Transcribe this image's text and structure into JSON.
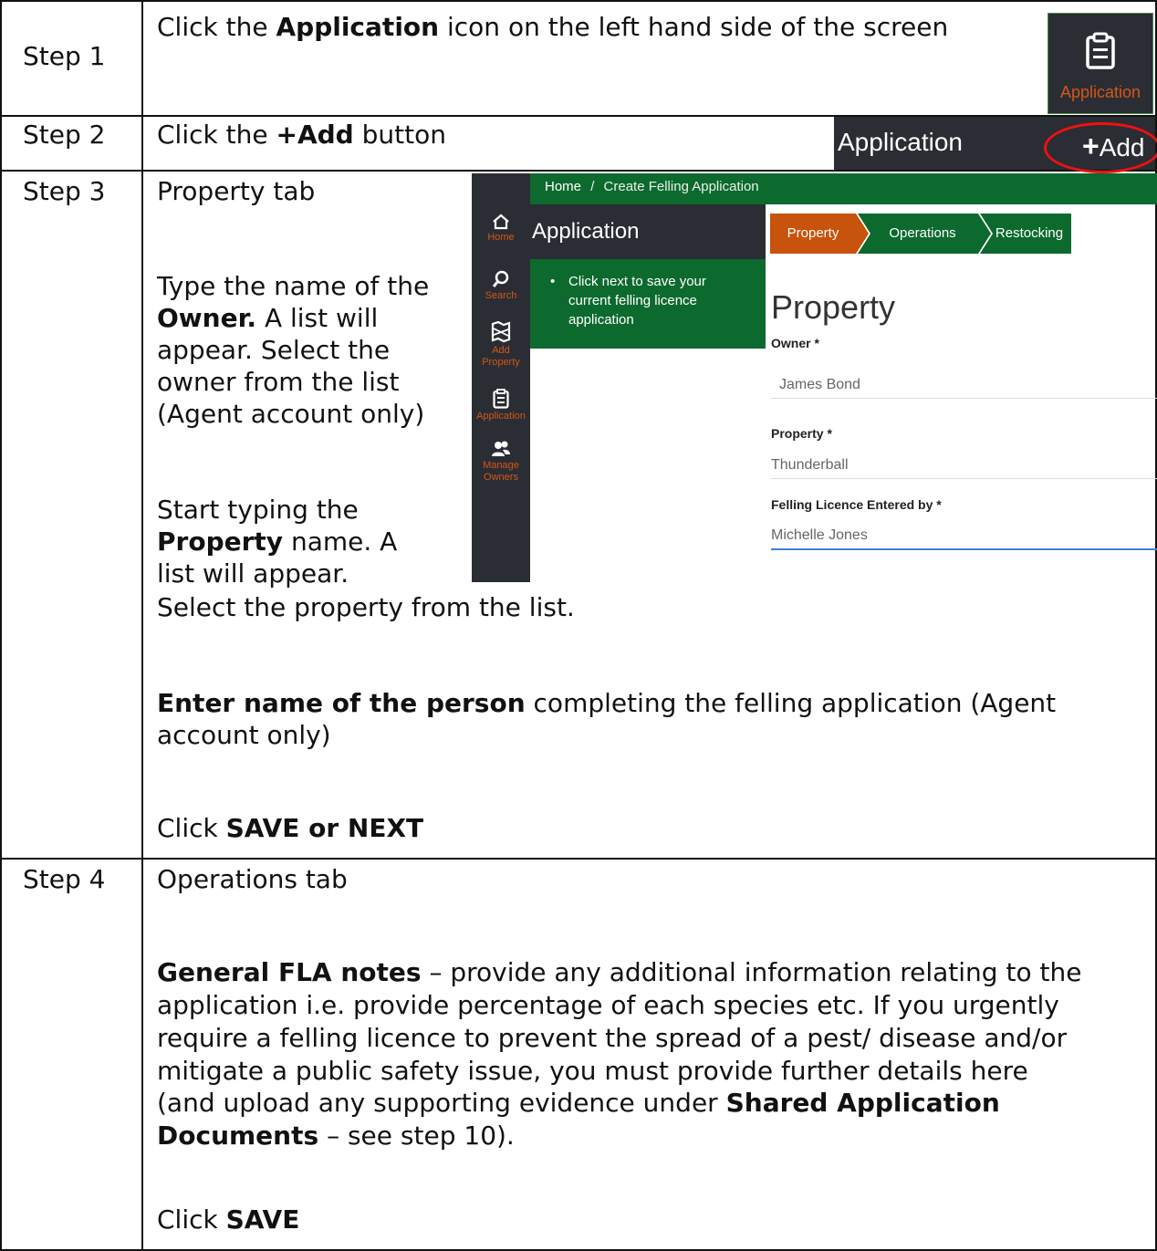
{
  "steps": [
    {
      "label": "Step 1",
      "text_pre": "Click the ",
      "text_bold": "Application",
      "text_post": " icon on the left hand side of the screen",
      "icon": {
        "name": "clipboard-icon",
        "label": "Application"
      }
    },
    {
      "label": "Step 2",
      "text_pre": "Click the ",
      "text_bold": "+Add",
      "text_post": " button",
      "toolbar": {
        "title": "Application",
        "add_label": "Add"
      }
    },
    {
      "label": "Step 3",
      "tab_line": "Property tab",
      "owner_1": "Type the name of the",
      "owner_2_bold": "Owner.",
      "owner_2_rest": " A list will",
      "owner_3": "appear. Select the",
      "owner_4": "owner from the list",
      "owner_5": "(Agent account only)",
      "prop_1": "Start typing the",
      "prop_2_bold": "Property",
      "prop_2_rest": " name. A",
      "prop_3": "list will appear.",
      "prop_4": "Select the property from the list.",
      "person_bold": "Enter name of the person",
      "person_rest_1": " completing the felling application (Agent",
      "person_rest_2": "account only)",
      "click_pre": "Click ",
      "click_bold": "SAVE or NEXT"
    },
    {
      "label": "Step 4",
      "tab_line": "Operations tab",
      "notes_bold": "General FLA notes",
      "notes_1": " – provide any additional information relating to the",
      "notes_2": "application i.e. provide percentage of each species etc. If you urgently",
      "notes_3": "require a felling licence to prevent the spread of a pest/ disease and/or",
      "notes_4": "mitigate a public safety issue, you must provide further details here",
      "notes_5_pre": "(and upload any supporting evidence under ",
      "notes_5_bold": "Shared Application",
      "notes_6_bold": "Documents",
      "notes_6_rest": " – see step 10).",
      "click_pre": "Click ",
      "click_bold": "SAVE"
    }
  ],
  "screenshot": {
    "breadcrumb_home": "Home",
    "breadcrumb_sep": "/",
    "breadcrumb_current": "Create Felling Application",
    "nav": [
      {
        "label": "Home",
        "icon": "home-icon"
      },
      {
        "label": "Search",
        "icon": "search-icon"
      },
      {
        "label": "Add Property",
        "icon": "map-icon"
      },
      {
        "label": "Application",
        "icon": "clipboard-icon"
      },
      {
        "label": "Manage Owners",
        "icon": "users-icon"
      }
    ],
    "panel_title": "Application",
    "panel_note": "Click next to save your current felling licence application",
    "tabs": [
      "Property",
      "Operations",
      "Restocking"
    ],
    "form_title": "Property",
    "fields": [
      {
        "label": "Owner *",
        "value": "James Bond"
      },
      {
        "label": "Property *",
        "value": "Thunderball"
      },
      {
        "label": "Felling Licence Entered by *",
        "value": "Michelle Jones"
      }
    ]
  }
}
